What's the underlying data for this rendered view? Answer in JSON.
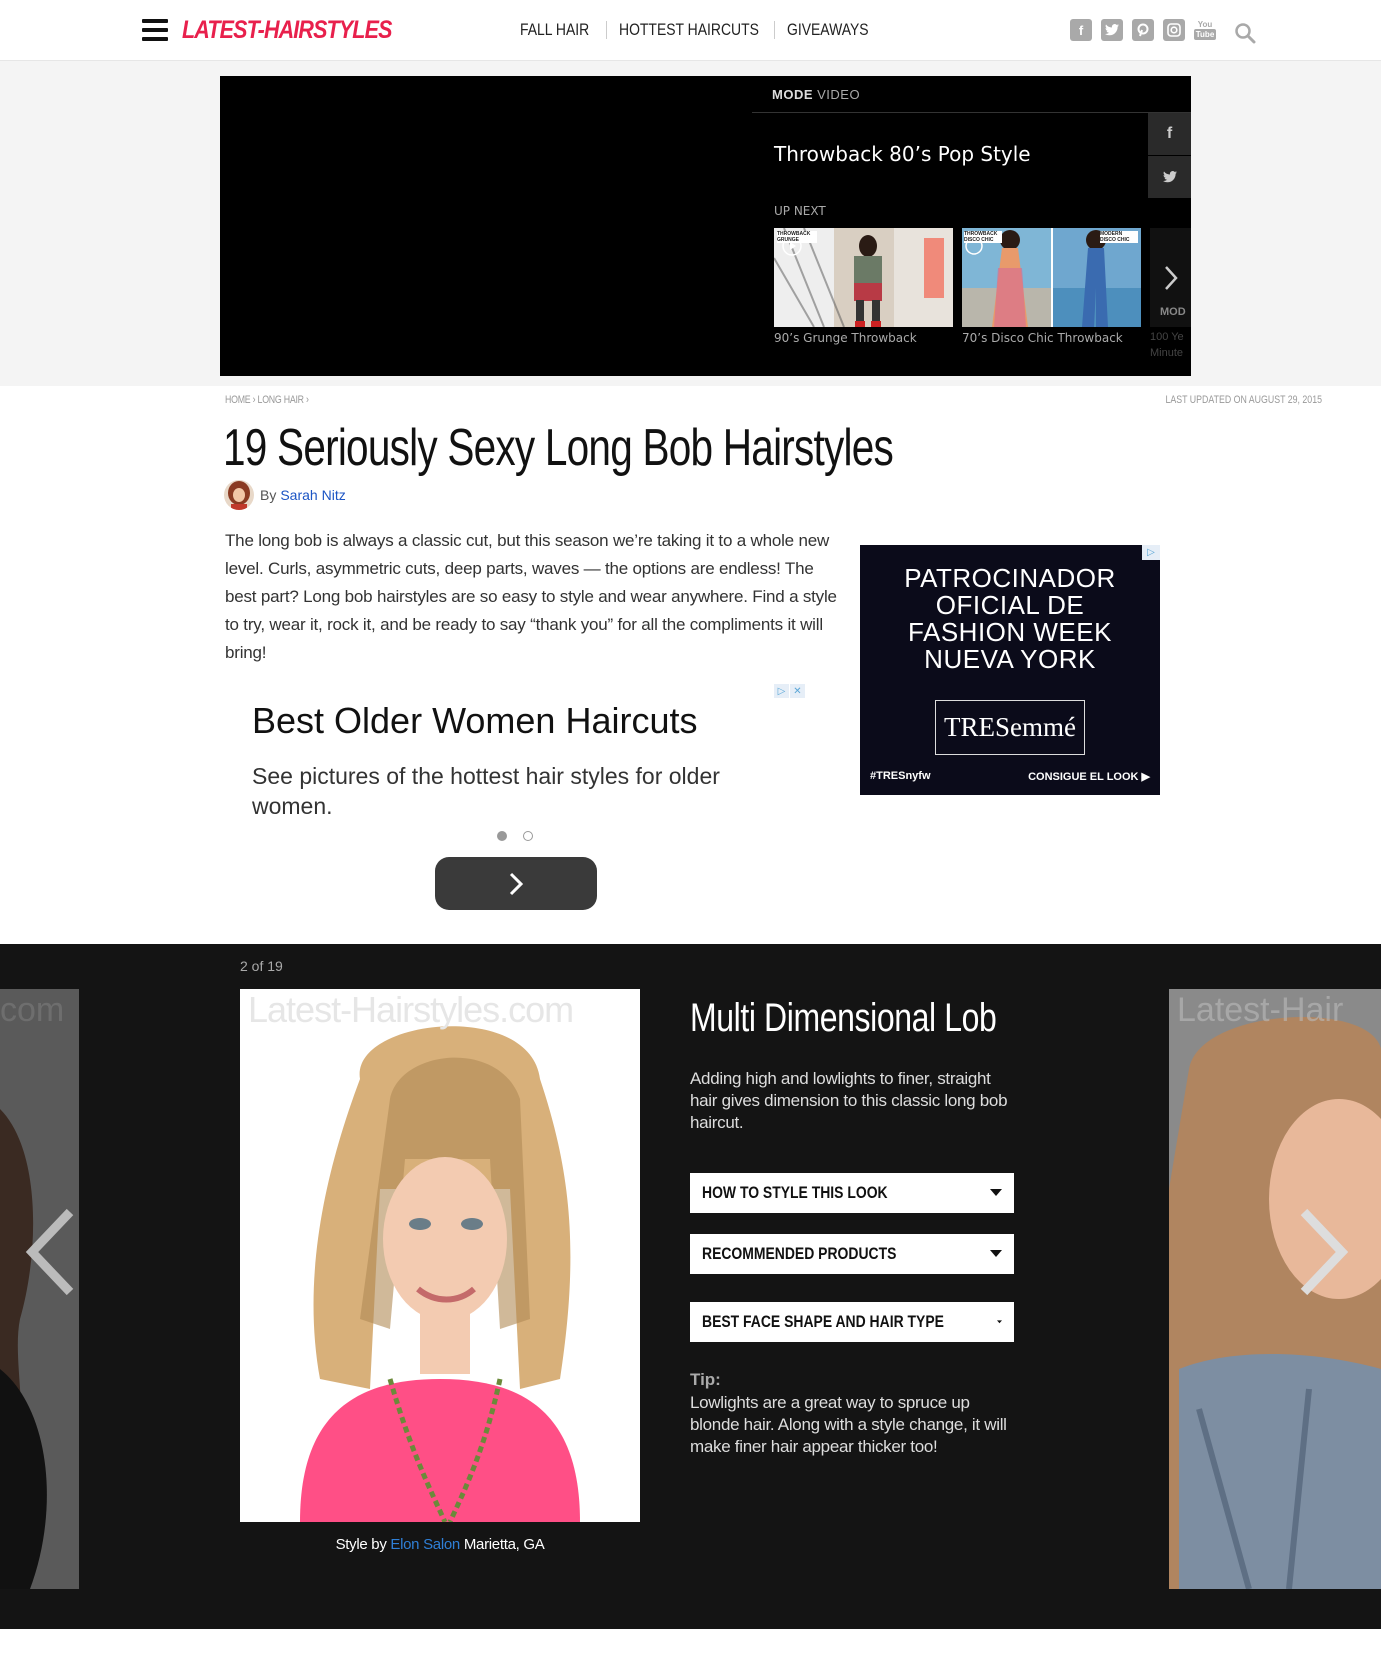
{
  "header": {
    "logo": "LATEST-HAIRSTYLES",
    "nav": [
      "FALL HAIR",
      "HOTTEST HAIRCUTS",
      "GIVEAWAYS"
    ],
    "social_icons": [
      "facebook-icon",
      "twitter-icon",
      "pinterest-icon",
      "instagram-icon",
      "youtube-icon"
    ],
    "youtube_label_top": "You",
    "youtube_label_bottom": "Tube"
  },
  "video": {
    "brand_bold": "MODE",
    "brand_light": "VIDEO",
    "title": "Throwback 80’s Pop Style",
    "up_next": "UP NEXT",
    "side_buttons": [
      "f",
      "t"
    ],
    "thumbnails": [
      {
        "label": "90’s Grunge Throwback",
        "tag": "THROWBACK GRUNGE"
      },
      {
        "label": "70’s Disco Chic Throwback",
        "tag_left": "THROWBACK DISCO CHIC",
        "tag_right": "MODERN DISCO CHIC"
      }
    ],
    "overflow_label": "MOD",
    "overflow_sub_1": "100 Ye",
    "overflow_sub_2": "Minute"
  },
  "article": {
    "breadcrumb": "HOME › LONG HAIR ›",
    "updated": "LAST UPDATED ON AUGUST 29, 2015",
    "title": "19 Seriously Sexy Long Bob Hairstyles",
    "by": "By",
    "author": "Sarah Nitz",
    "intro": "The long bob is always a classic cut, but this season we’re taking it to a whole new level.  Curls, asymmetric cuts, deep parts, waves — the options are endless! The best part? Long bob hairstyles are so easy to style and wear anywhere. Find a style to try, wear it, rock it, and be ready to say “thank you” for all the compliments it will bring!"
  },
  "native_ad": {
    "title": "Best Older Women Haircuts",
    "description": "See pictures of the hottest hair styles for older women.",
    "dots": 2,
    "active_dot": 0
  },
  "sponsor_ad": {
    "lines": [
      "PATROCINADOR",
      "OFICIAL DE",
      "FASHION WEEK",
      "NUEVA YORK"
    ],
    "brand": "TRESemmé",
    "hashtag": "#TRESnyfw",
    "cta": "CONSIGUE EL LOOK ▶"
  },
  "gallery": {
    "counter": "2 of 19",
    "watermark": "Latest-Hairstyles.com",
    "watermark_left": "com",
    "watermark_right": "Latest-Hair",
    "style_by": "Style by",
    "salon": "Elon Salon",
    "location": "Marietta, GA",
    "title": "Multi Dimensional Lob",
    "description": "Adding high and lowlights to finer, straight hair gives dimension to this classic long bob haircut.",
    "dropdowns": [
      "HOW TO STYLE THIS LOOK",
      "RECOMMENDED PRODUCTS",
      "BEST FACE SHAPE AND HAIR TYPE"
    ],
    "tip_label": "Tip:",
    "tip": "Lowlights are a great way to spruce up blonde hair. Along with a style change, it will make finer hair appear thicker too!"
  },
  "colors": {
    "brand_pink": "#e8204c",
    "link_blue": "#1b54c4",
    "gallery_bg": "#141414",
    "photo_top": "#ff4f86"
  }
}
